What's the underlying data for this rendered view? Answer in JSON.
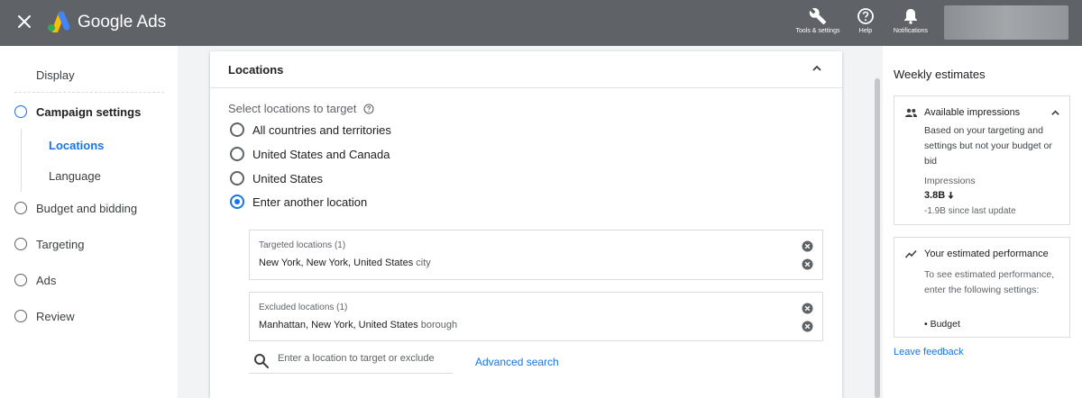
{
  "app": {
    "title": "Google Ads"
  },
  "topbar": {
    "tools_label": "Tools & settings",
    "help_label": "Help",
    "notifications_label": "Notifications"
  },
  "nav": {
    "display": "Display",
    "campaign_settings": "Campaign settings",
    "sub_items": [
      "Locations",
      "Language"
    ],
    "budget": "Budget and bidding",
    "targeting": "Targeting",
    "ads": "Ads",
    "review": "Review"
  },
  "locations": {
    "title": "Locations",
    "select_label": "Select locations to target",
    "options": [
      "All countries and territories",
      "United States and Canada",
      "United States",
      "Enter another location"
    ],
    "selected_option": "Enter another location",
    "targeted_title": "Targeted locations (1)",
    "targeted_value": "New York, New York, United States",
    "targeted_kind": "city",
    "excluded_title": "Excluded locations (1)",
    "excluded_value": "Manhattan, New York, United States",
    "excluded_kind": "borough",
    "search_placeholder": "Enter a location to target or exclude",
    "advanced_search": "Advanced search"
  },
  "estimates": {
    "title": "Weekly estimates",
    "impressions_header": "Available impressions",
    "impressions_desc": "Based on your targeting and settings but not your budget or bid",
    "impressions_label": "Impressions",
    "impressions_value": "3.8B",
    "impressions_change": "-1.9B since last update",
    "performance_header": "Your estimated performance",
    "performance_desc": "To see estimated performance, enter the following settings:",
    "performance_item": "Budget",
    "feedback": "Leave feedback"
  },
  "colors": {
    "accent": "#1a73e8",
    "topbar": "#5f6368"
  },
  "icons": [
    "close-icon",
    "google-ads-logo",
    "wrench-icon",
    "help-icon",
    "bell-icon",
    "info-icon",
    "clear-icon",
    "search-icon",
    "people-icon",
    "trend-icon",
    "chevron-up-icon",
    "arrow-down-icon"
  ]
}
